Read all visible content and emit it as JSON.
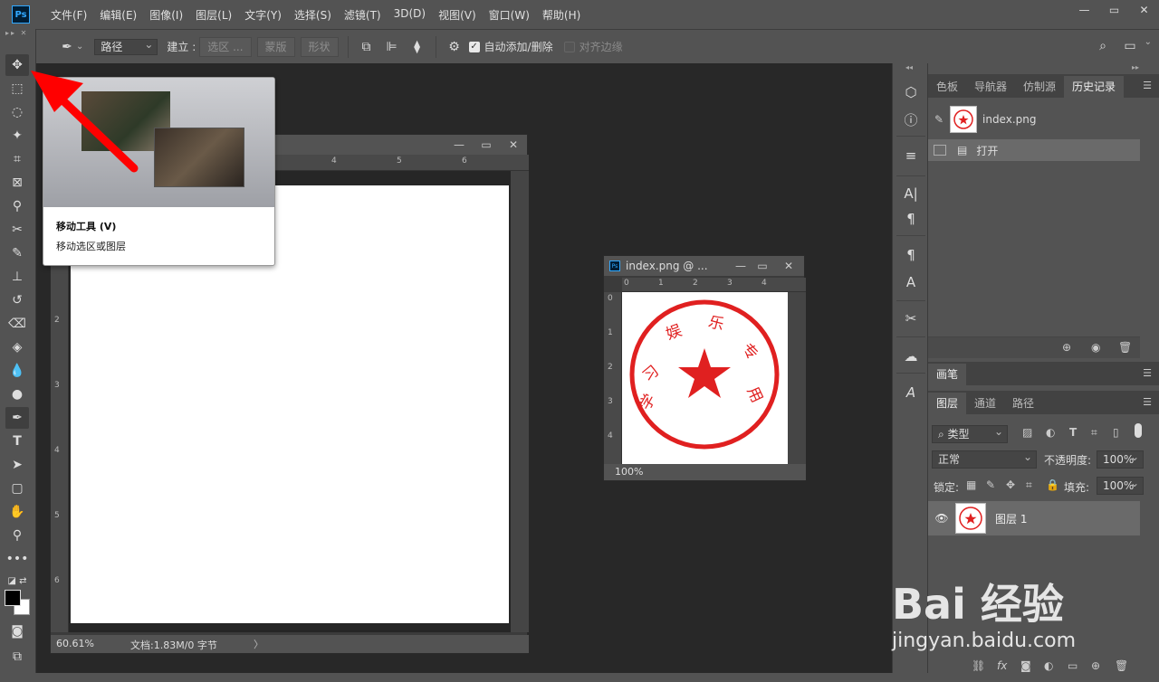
{
  "app": {
    "logo": "Ps"
  },
  "menu": [
    "文件(F)",
    "编辑(E)",
    "图像(I)",
    "图层(L)",
    "文字(Y)",
    "选择(S)",
    "滤镜(T)",
    "3D(D)",
    "视图(V)",
    "窗口(W)",
    "帮助(H)"
  ],
  "window_controls": {
    "minimize": "—",
    "restore": "▭",
    "close": "✕"
  },
  "options": {
    "mode_value": "路径",
    "make_label": "建立 :",
    "selection_btn": "选区 ...",
    "mask_btn": "蒙版",
    "shape_btn": "形状",
    "auto_add_label": "自动添加/删除",
    "align_edges_label": "对齐边缘"
  },
  "tooltip": {
    "title": "移动工具 (V)",
    "description": "移动选区或图层"
  },
  "doc_main": {
    "zoom": "60.61%",
    "status": "文档:1.83M/0 字节",
    "ruler_h": [
      "4",
      "5",
      "6"
    ],
    "ruler_v": [
      "2",
      "3",
      "4",
      "5",
      "6"
    ]
  },
  "doc_stamp": {
    "title": "index.png @ ...",
    "zoom": "100%",
    "ruler_h": [
      "0",
      "1",
      "2",
      "3",
      "4"
    ],
    "ruler_v": [
      "0",
      "1",
      "2",
      "3",
      "4"
    ],
    "stamp_chars": [
      "学",
      "习",
      "娱",
      "乐",
      "专",
      "用"
    ]
  },
  "panels": {
    "top_tabs": [
      "色板",
      "导航器",
      "仿制源",
      "历史记录"
    ],
    "history_snapshot": "index.png",
    "history_item": "打开",
    "brush_tab": "画笔",
    "layer_tabs": [
      "图层",
      "通道",
      "路径"
    ],
    "filter_kind": "类型",
    "blend_mode": "正常",
    "opacity_label": "不透明度:",
    "opacity_value": "100%",
    "lock_label": "锁定:",
    "fill_label": "填充:",
    "fill_value": "100%",
    "layer_name": "图层 1"
  },
  "watermark": {
    "brand": "Bai  经验",
    "url": "jingyan.baidu.com"
  },
  "colors": {
    "accent": "#31a8ff",
    "stamp_red": "#e02020",
    "arrow_red": "#ff0000"
  }
}
